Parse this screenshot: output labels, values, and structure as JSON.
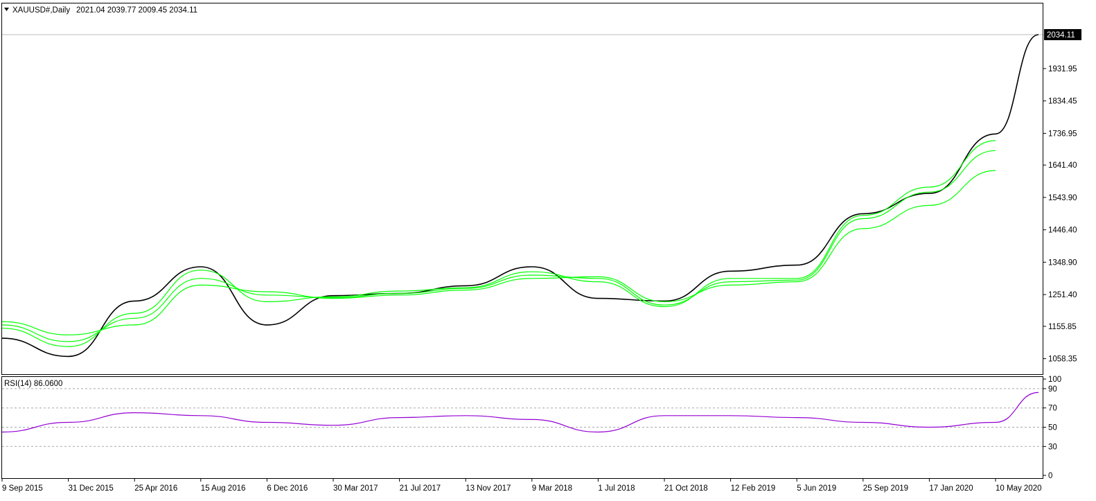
{
  "header": {
    "symbol_label": "XAUUSD#,Daily",
    "ohlc": "2021.04 2039.77 2009.45 2034.11"
  },
  "price_panel": {
    "current_price_label": "2034.11",
    "y_ticks": [
      "1931.95",
      "1834.45",
      "1736.95",
      "1641.40",
      "1543.90",
      "1446.40",
      "1348.90",
      "1251.40",
      "1155.85",
      "1058.35"
    ],
    "colors": {
      "price": "#000000",
      "ma": "#00ff00",
      "current_box": "#000000"
    }
  },
  "rsi_panel": {
    "label": "RSI(14) 86.0600",
    "y_ticks": [
      "100",
      "90",
      "70",
      "50",
      "30",
      "0"
    ],
    "color": "#9400d3"
  },
  "x_axis": {
    "labels": [
      "9 Sep 2015",
      "31 Dec 2015",
      "25 Apr 2016",
      "15 Aug 2016",
      "6 Dec 2016",
      "30 Mar 2017",
      "21 Jul 2017",
      "13 Nov 2017",
      "9 Mar 2018",
      "1 Jul 2018",
      "21 Oct 2018",
      "12 Feb 2019",
      "5 Jun 2019",
      "25 Sep 2019",
      "17 Jan 2020",
      "10 May 2020"
    ]
  },
  "chart_data": [
    {
      "type": "line",
      "title": "XAUUSD#,Daily",
      "x": [
        "9 Sep 2015",
        "31 Dec 2015",
        "25 Apr 2016",
        "15 Aug 2016",
        "6 Dec 2016",
        "30 Mar 2017",
        "21 Jul 2017",
        "13 Nov 2017",
        "9 Mar 2018",
        "1 Jul 2018",
        "21 Oct 2018",
        "12 Feb 2019",
        "5 Jun 2019",
        "25 Sep 2019",
        "17 Jan 2020",
        "10 May 2020"
      ],
      "series": [
        {
          "values": [
            1120,
            1065,
            1232,
            1335,
            1160,
            1248,
            1255,
            1278,
            1335,
            1240,
            1232,
            1322,
            1340,
            1495,
            1556,
            1735
          ]
        },
        {
          "values": [
            1150,
            1095,
            1195,
            1325,
            1230,
            1245,
            1262,
            1272,
            1320,
            1290,
            1215,
            1300,
            1300,
            1490,
            1575,
            1715
          ]
        },
        {
          "values": [
            1160,
            1110,
            1180,
            1300,
            1250,
            1242,
            1255,
            1270,
            1310,
            1300,
            1220,
            1290,
            1295,
            1480,
            1560,
            1685
          ]
        },
        {
          "values": [
            1170,
            1130,
            1160,
            1280,
            1260,
            1240,
            1250,
            1265,
            1300,
            1305,
            1230,
            1280,
            1290,
            1450,
            1520,
            1625
          ]
        }
      ],
      "ylim": [
        1020,
        2080
      ],
      "last_value": 2034.11
    },
    {
      "type": "line",
      "title": "RSI(14) 86.0600",
      "x": [
        "9 Sep 2015",
        "31 Dec 2015",
        "25 Apr 2016",
        "15 Aug 2016",
        "6 Dec 2016",
        "30 Mar 2017",
        "21 Jul 2017",
        "13 Nov 2017",
        "9 Mar 2018",
        "1 Jul 2018",
        "21 Oct 2018",
        "12 Feb 2019",
        "5 Jun 2019",
        "25 Sep 2019",
        "17 Jan 2020",
        "10 May 2020"
      ],
      "series": [
        {
          "values": [
            45,
            55,
            65,
            62,
            55,
            52,
            60,
            62,
            58,
            45,
            62,
            62,
            60,
            55,
            50,
            55
          ]
        }
      ],
      "ylim": [
        0,
        100
      ],
      "levels": [
        30,
        50,
        70,
        90
      ],
      "last_value": 86.06
    }
  ]
}
